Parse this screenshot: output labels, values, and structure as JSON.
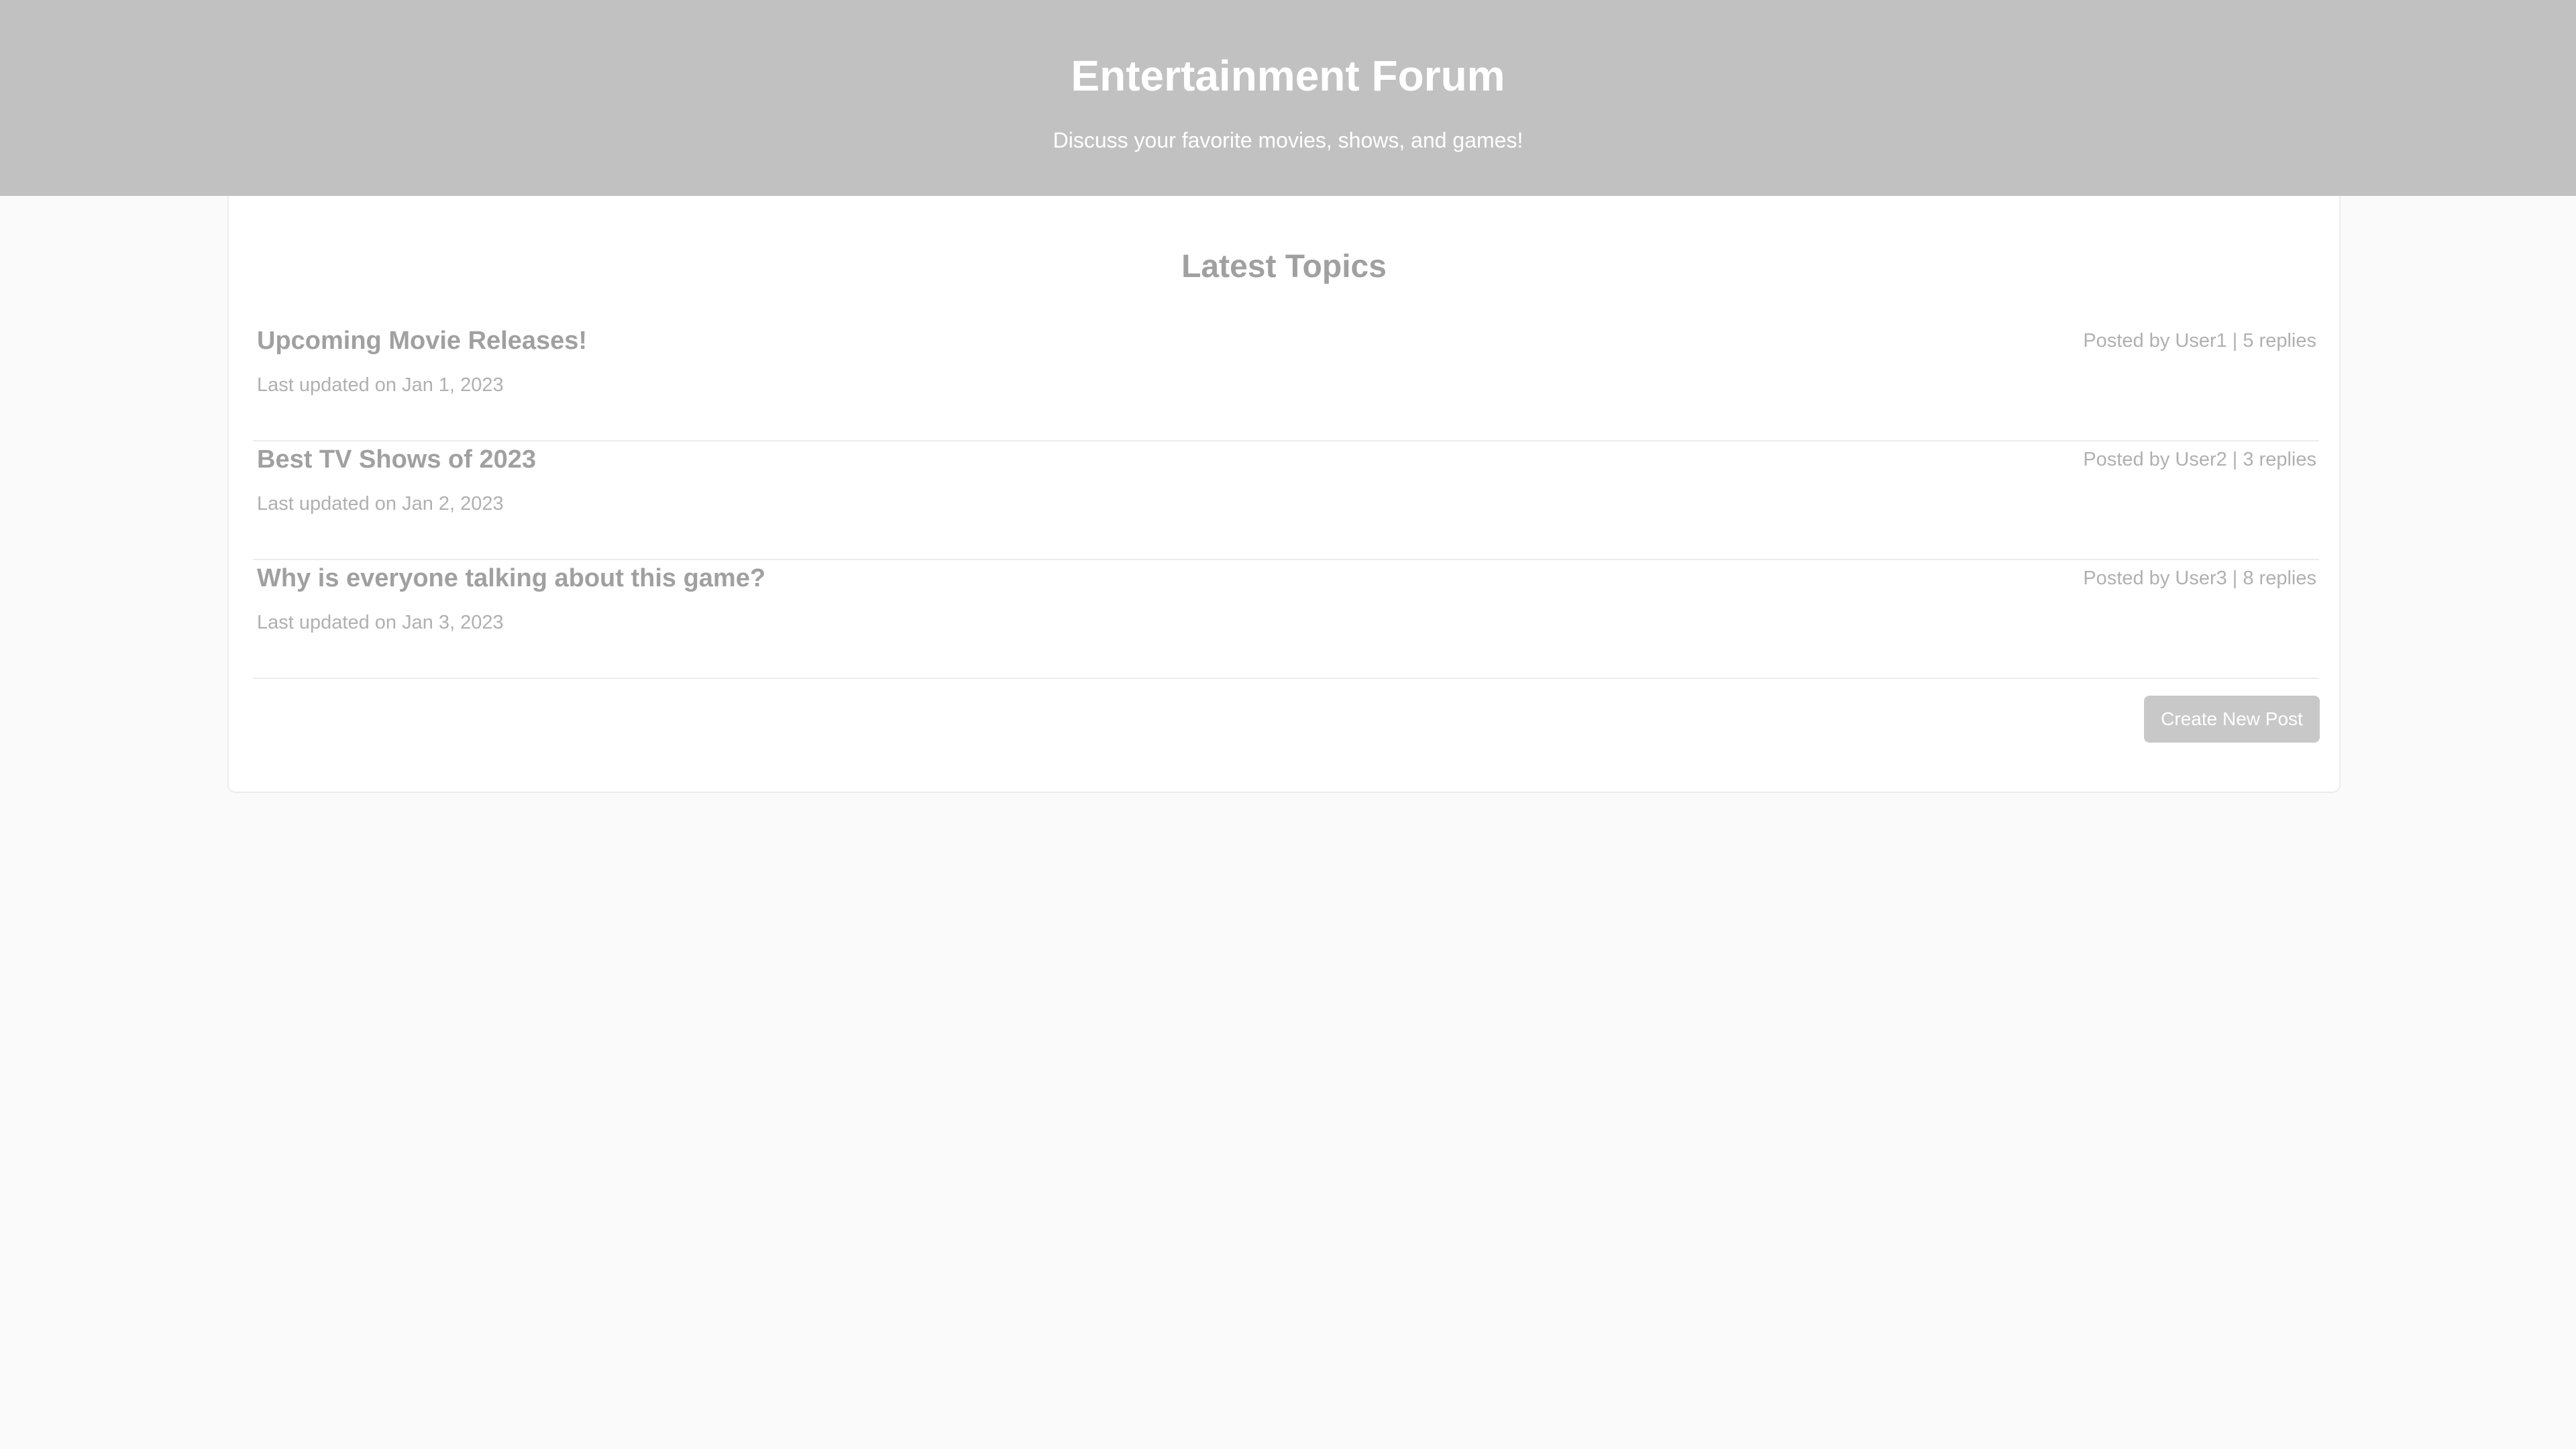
{
  "header": {
    "title": "Entertainment Forum",
    "subtitle": "Discuss your favorite movies, shows, and games!"
  },
  "main": {
    "section_title": "Latest Topics",
    "topics": [
      {
        "title": "Upcoming Movie Releases!",
        "meta": "Posted by User1 | 5 replies",
        "updated": "Last updated on Jan 1, 2023"
      },
      {
        "title": "Best TV Shows of 2023",
        "meta": "Posted by User2 | 3 replies",
        "updated": "Last updated on Jan 2, 2023"
      },
      {
        "title": "Why is everyone talking about this game?",
        "meta": "Posted by User3 | 8 replies",
        "updated": "Last updated on Jan 3, 2023"
      }
    ],
    "create_button_label": "Create New Post"
  },
  "colors": {
    "header_background": "#c1c1c1",
    "page_background": "#fafafa",
    "text_muted": "#a0a0a0",
    "button_background": "#c8c8c8"
  }
}
